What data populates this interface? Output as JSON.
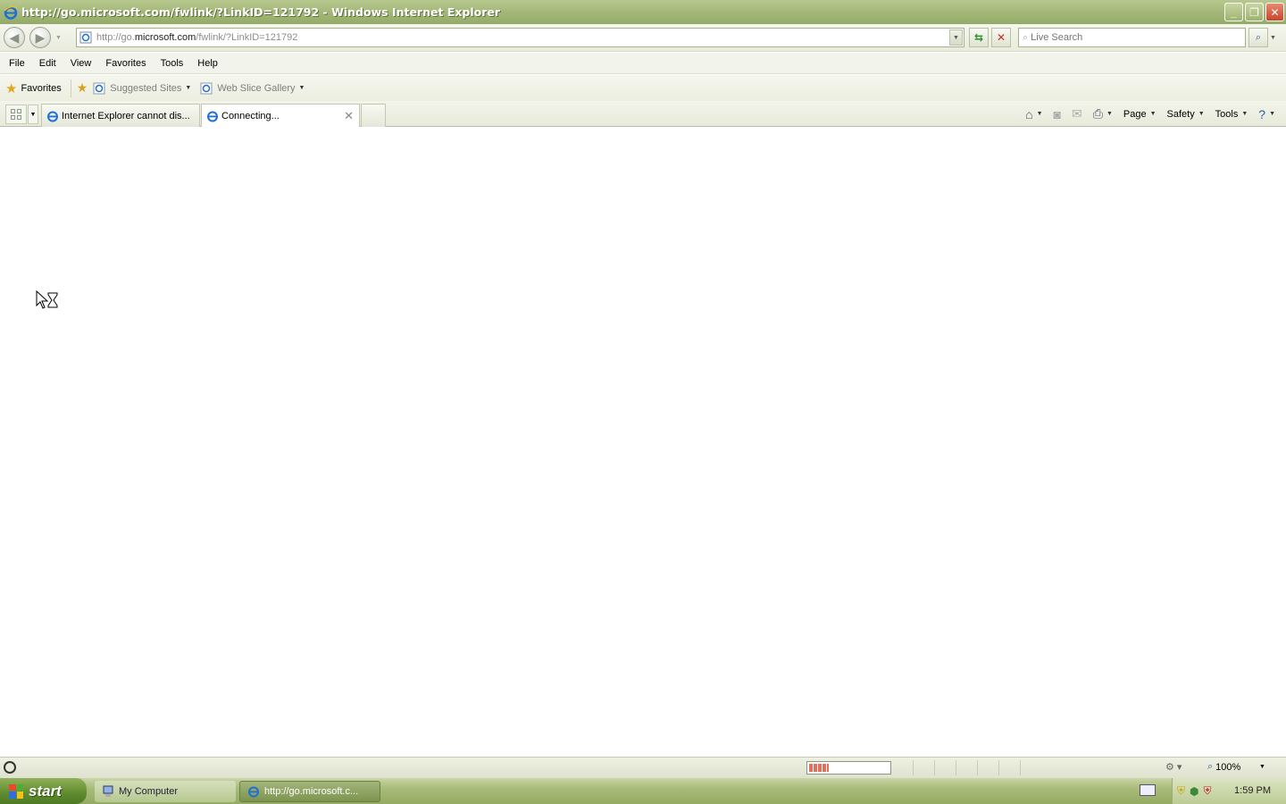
{
  "window": {
    "title": "http://go.microsoft.com/fwlink/?LinkID=121792 - Windows Internet Explorer",
    "controls": [
      "minimize-icon",
      "restore-icon",
      "close-icon"
    ]
  },
  "address_bar": {
    "url_prefix": "http://go.",
    "url_domain": "microsoft.com",
    "url_path": "/fwlink/?LinkID=121792",
    "search_placeholder": "Live Search"
  },
  "menu": [
    "File",
    "Edit",
    "View",
    "Favorites",
    "Tools",
    "Help"
  ],
  "favorites_bar": {
    "favorites_label": "Favorites",
    "links": [
      {
        "label": "Suggested Sites"
      },
      {
        "label": "Web Slice Gallery"
      }
    ]
  },
  "tabs": [
    {
      "label": "Internet Explorer cannot dis...",
      "active": false
    },
    {
      "label": "Connecting...",
      "active": true
    }
  ],
  "command_bar": {
    "page_label": "Page",
    "safety_label": "Safety",
    "tools_label": "Tools"
  },
  "status_bar": {
    "progress_fraction": 0.25,
    "zoom": "100%"
  },
  "taskbar": {
    "start_label": "start",
    "items": [
      {
        "label": "My Computer"
      },
      {
        "label": "http://go.microsoft.c..."
      }
    ],
    "clock": "1:59 PM"
  },
  "colors": {
    "titlebar": "#a3b878",
    "start_button": "#5e8b2e",
    "progress_fill": "#e0715c"
  }
}
